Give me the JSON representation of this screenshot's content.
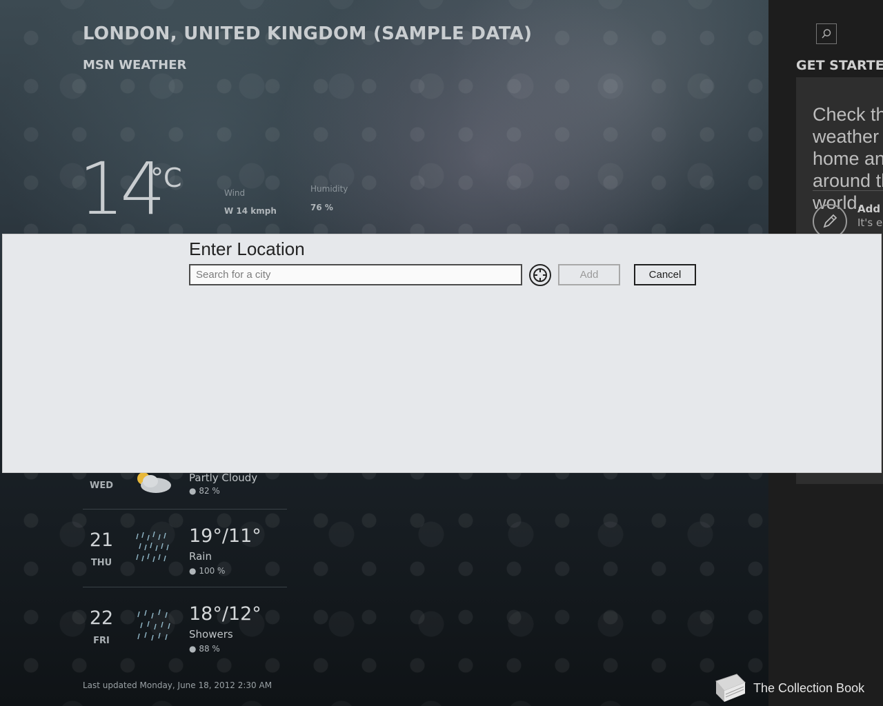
{
  "weather": {
    "city": "LONDON, UNITED KINGDOM (SAMPLE DATA)",
    "app_name": "MSN WEATHER",
    "temperature": "14",
    "unit": "°C",
    "wind_label": "Wind",
    "wind_value": "W 14 kmph",
    "humidity_label": "Humidity",
    "humidity_value": "76 %",
    "forecast": [
      {
        "day_num": "",
        "day_name": "WED",
        "temps": "",
        "condition": "Partly Cloudy",
        "precip": "82 %",
        "icon": "partly-cloudy-icon"
      },
      {
        "day_num": "21",
        "day_name": "THU",
        "temps": "19°/11°",
        "condition": "Rain",
        "precip": "100 %",
        "icon": "rain-icon"
      },
      {
        "day_num": "22",
        "day_name": "FRI",
        "temps": "18°/12°",
        "condition": "Showers",
        "precip": "88 %",
        "icon": "showers-icon"
      }
    ],
    "last_updated": "Last updated Monday, June 18, 2012 2:30 AM"
  },
  "side_panel": {
    "heading": "GET STARTED",
    "card_text": "Check the weather at home and around the world.",
    "add_title": "Add y",
    "add_sub": "It's ea"
  },
  "dialog": {
    "title": "Enter Location",
    "search_placeholder": "Search for a city",
    "search_value": "",
    "add_label": "Add",
    "cancel_label": "Cancel"
  },
  "taskbar": {
    "book_label": "The Collection Book"
  },
  "colors": {
    "dialog_bg": "#e6e8eb",
    "side_panel_bg": "#1d1d1d"
  }
}
